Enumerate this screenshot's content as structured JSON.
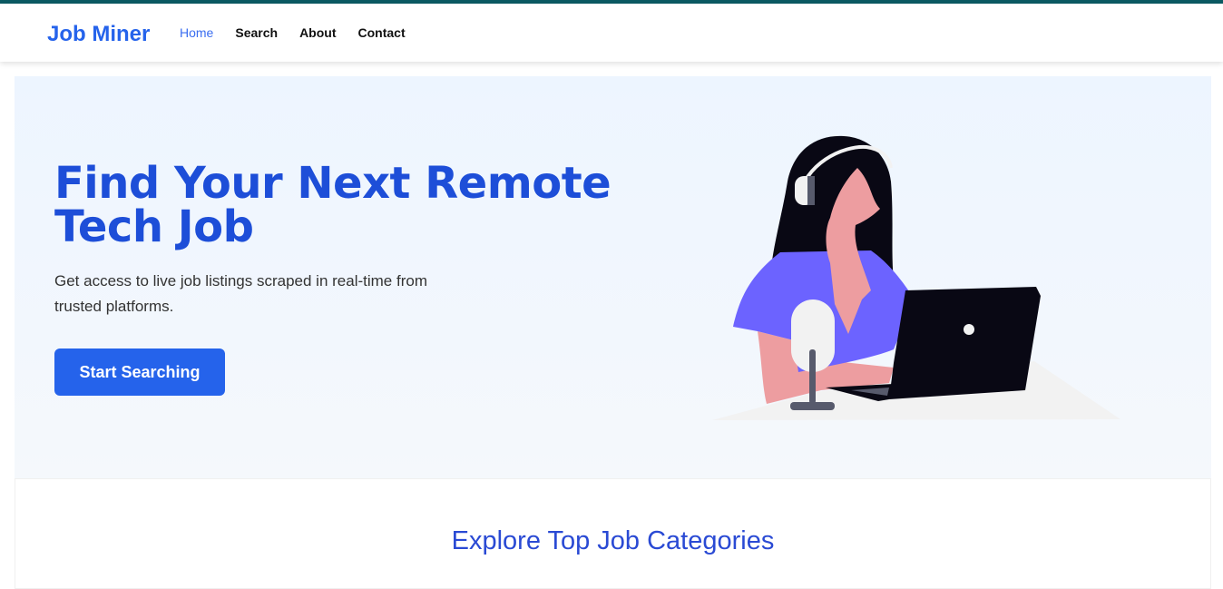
{
  "nav": {
    "brand": "Job Miner",
    "links": [
      {
        "label": "Home",
        "active": true
      },
      {
        "label": "Search",
        "active": false
      },
      {
        "label": "About",
        "active": false
      },
      {
        "label": "Contact",
        "active": false
      }
    ]
  },
  "hero": {
    "title": "Find Your Next Remote Tech Job",
    "subtitle": "Get access to live job listings scraped in real-time from trusted platforms.",
    "cta_label": "Start Searching",
    "illustration_icon": "woman-with-headset-laptop-illustration"
  },
  "categories": {
    "heading": "Explore Top Job Categories"
  },
  "colors": {
    "accent": "#2563eb",
    "heading": "#1d4ed8",
    "topbar": "#0b5a63"
  }
}
